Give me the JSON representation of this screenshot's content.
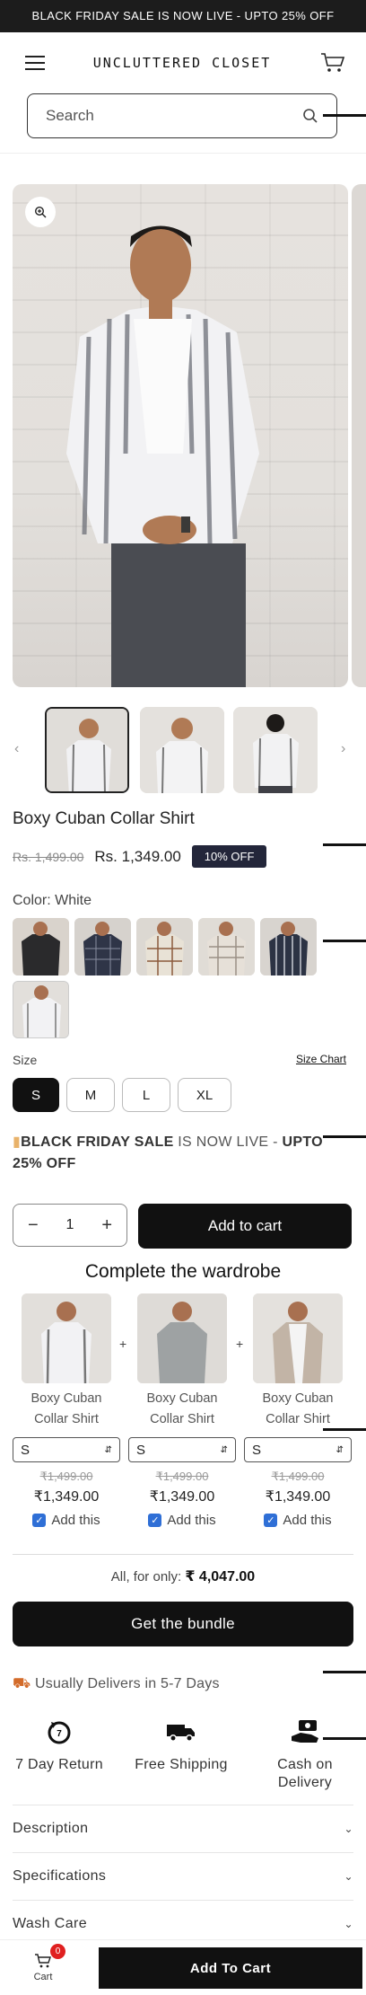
{
  "announcement": "BLACK FRIDAY SALE IS NOW LIVE - UPTO 25% OFF",
  "header": {
    "logo": "UNCLUTTERED CLOSET"
  },
  "search": {
    "placeholder": "Search"
  },
  "product": {
    "title": "Boxy Cuban Collar Shirt",
    "old_price": "Rs. 1,499.00",
    "price": "Rs. 1,349.00",
    "discount_badge": "10% OFF",
    "color_label": "Color: White",
    "size_label": "Size",
    "size_chart_link": "Size Chart",
    "sizes": [
      "S",
      "M",
      "L",
      "XL"
    ],
    "selected_size": "S",
    "quantity": "1",
    "add_to_cart": "Add to cart"
  },
  "banner": {
    "prefix": "BLACK FRIDAY SALE",
    "middle": " IS NOW LIVE - ",
    "suffix": "UPTO 25% OFF"
  },
  "bundle": {
    "heading": "Complete the wardrobe",
    "items": [
      {
        "name": "Boxy Cuban Collar Shirt",
        "size": "S",
        "old_price": "₹1,499.00",
        "price": "₹1,349.00",
        "add_label": "Add this"
      },
      {
        "name": "Boxy Cuban Collar Shirt",
        "size": "S",
        "old_price": "₹1,499.00",
        "price": "₹1,349.00",
        "add_label": "Add this"
      },
      {
        "name": "Boxy Cuban Collar Shirt",
        "size": "S",
        "old_price": "₹1,499.00",
        "price": "₹1,349.00",
        "add_label": "Add this"
      }
    ],
    "plus": "+",
    "all_for_label": "All, for only:",
    "all_for_price": "₹ 4,047.00",
    "cta": "Get the bundle"
  },
  "delivery": "Usually Delivers in 5-7 Days",
  "features": [
    {
      "label": "7 Day Return",
      "icon": "return-icon"
    },
    {
      "label": "Free Shipping",
      "icon": "truck-icon"
    },
    {
      "label": "Cash on Delivery",
      "icon": "cash-icon"
    }
  ],
  "accordions": [
    "Description",
    "Specifications",
    "Wash Care"
  ],
  "sticky": {
    "cart_label": "Cart",
    "cart_count": "0",
    "add_label": "Add To Cart"
  },
  "colors": {
    "brand_dark": "#111111",
    "badge": "#23263a",
    "check": "#2f6fd6",
    "cart_badge": "#e02020"
  }
}
